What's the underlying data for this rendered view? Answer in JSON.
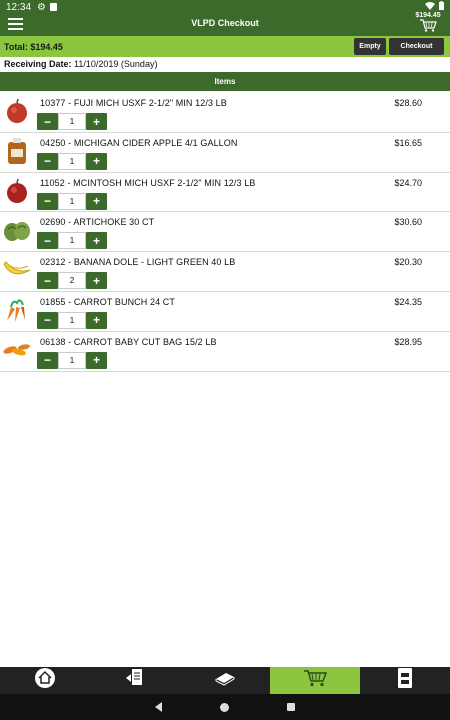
{
  "status_bar": {
    "time": "12:34"
  },
  "app_bar": {
    "title": "VLPD Checkout",
    "cart_amount": "$194.45"
  },
  "total_bar": {
    "total_label": "Total:",
    "total_value": "$194.45",
    "empty_label": "Empty",
    "checkout_label": "Checkout"
  },
  "receiving": {
    "label": "Receiving Date:",
    "value": "11/10/2019 (Sunday)"
  },
  "items_header": "Items",
  "items": [
    {
      "name": "10377 - FUJI MICH USXF 2-1/2\" MIN 12/3 LB",
      "price": "$28.60",
      "qty": "1",
      "icon": "apple-icon"
    },
    {
      "name": "04250 - MICHIGAN CIDER APPLE 4/1 GALLON",
      "price": "$16.65",
      "qty": "1",
      "icon": "cider-jug-icon"
    },
    {
      "name": "11052 - MCINTOSH MICH USXF 2-1/2\" MIN 12/3 LB",
      "price": "$24.70",
      "qty": "1",
      "icon": "apple-icon"
    },
    {
      "name": "02690 - ARTICHOKE 30 CT",
      "price": "$30.60",
      "qty": "1",
      "icon": "artichoke-icon"
    },
    {
      "name": "02312 - BANANA DOLE - LIGHT GREEN 40 LB",
      "price": "$20.30",
      "qty": "2",
      "icon": "banana-icon"
    },
    {
      "name": "01855 - CARROT BUNCH 24 CT",
      "price": "$24.35",
      "qty": "1",
      "icon": "carrot-bunch-icon"
    },
    {
      "name": "06138 - CARROT BABY CUT BAG 15/2 LB",
      "price": "$28.95",
      "qty": "1",
      "icon": "baby-carrots-icon"
    }
  ],
  "stepper": {
    "minus": "−",
    "plus": "+"
  },
  "bottom_nav": [
    {
      "icon": "home-icon"
    },
    {
      "icon": "order-list-icon"
    },
    {
      "icon": "catalog-icon"
    },
    {
      "icon": "cart-icon",
      "active": true
    },
    {
      "icon": "scanner-icon"
    }
  ],
  "colors": {
    "primary": "#3c6a2b",
    "accent": "#8cc63f",
    "nav_bg": "#222222"
  }
}
